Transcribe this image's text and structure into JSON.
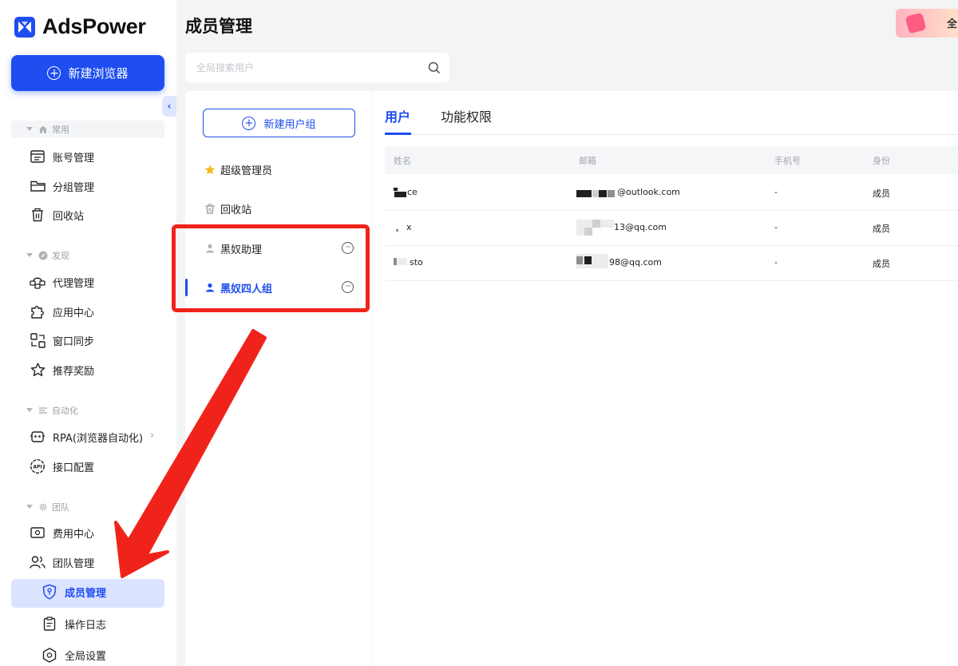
{
  "app": {
    "logo_text": "AdsPower",
    "accent": "#1e4df0"
  },
  "sidebar": {
    "new_browser_label": "新建浏览器",
    "sections": {
      "common": "常用",
      "discover": "发现",
      "automation": "自动化",
      "team": "团队"
    },
    "items": {
      "accounts": "账号管理",
      "groups": "分组管理",
      "trash": "回收站",
      "proxy": "代理管理",
      "apps": "应用中心",
      "sync": "窗口同步",
      "referral": "推荐奖励",
      "rpa": "RPA(浏览器自动化)",
      "api": "接口配置",
      "billing": "费用中心",
      "team_mgmt": "团队管理",
      "members": "成员管理",
      "logs": "操作日志",
      "settings": "全局设置"
    }
  },
  "header": {
    "title": "成员管理",
    "search_placeholder": "全局搜索用户",
    "banner_text": "全"
  },
  "groups": {
    "new_group_label": "新建用户组",
    "items": [
      "超级管理员",
      "回收站",
      "黑奴助理",
      "黑奴四人组"
    ],
    "selected": "黑奴四人组"
  },
  "tabs": [
    "用户",
    "功能权限"
  ],
  "table": {
    "columns": [
      "姓名",
      "邮箱",
      "手机号",
      "身份"
    ],
    "rows": [
      {
        "name": "ce",
        "email": "@outlook.com",
        "phone": "-",
        "role": "成员"
      },
      {
        "name": "x",
        "email": "13@qq.com",
        "phone": "-",
        "role": "成员"
      },
      {
        "name": "sto",
        "email": "98@qq.com",
        "phone": "-",
        "role": "成员"
      }
    ]
  }
}
